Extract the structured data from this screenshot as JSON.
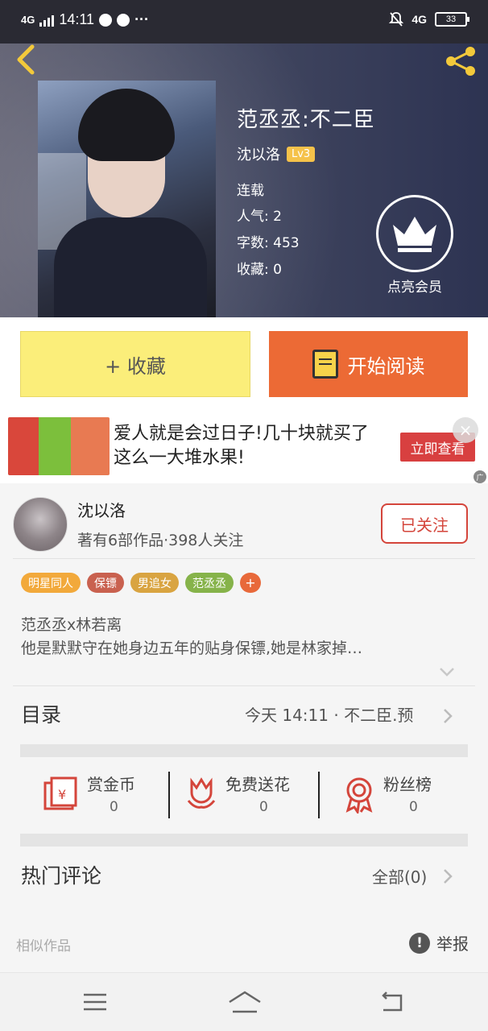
{
  "status_bar": {
    "network": "4G",
    "time": "14:11",
    "more": "···",
    "network_right": "4G",
    "battery": "33"
  },
  "book": {
    "title": "范丞丞:不二臣",
    "author": "沈以洛",
    "level": "Lv3",
    "status": "连载",
    "popularity_label": "人气:",
    "popularity": "2",
    "words_label": "字数:",
    "words": "453",
    "favorites_label": "收藏:",
    "favorites": "0"
  },
  "vip": {
    "label": "点亮会员"
  },
  "actions": {
    "collect": "+ 收藏",
    "read": "开始阅读"
  },
  "ad": {
    "text": "爱人就是会过日子!几十块就买了这么一大堆水果!",
    "cta": "立即查看",
    "close": "×",
    "mark": "广"
  },
  "author_card": {
    "name": "沈以洛",
    "stats": "著有6部作品·398人关注",
    "follow": "已关注"
  },
  "tags": [
    {
      "label": "明星同人",
      "color": "#f2a93b"
    },
    {
      "label": "保镖",
      "color": "#c9614f"
    },
    {
      "label": "男追女",
      "color": "#d9a441"
    },
    {
      "label": "范丞丞",
      "color": "#86b34a"
    },
    {
      "label": "+",
      "color": "#e8693a"
    }
  ],
  "synopsis": {
    "line1": "范丞丞x林若离",
    "line2": "他是默默守在她身边五年的贴身保镖,她是林家掉…"
  },
  "toc": {
    "label": "目录",
    "latest": "今天 14:11 · 不二臣.预"
  },
  "stats": [
    {
      "label": "赏金币",
      "value": "0"
    },
    {
      "label": "免费送花",
      "value": "0"
    },
    {
      "label": "粉丝榜",
      "value": "0"
    }
  ],
  "comments": {
    "label": "热门评论",
    "all": "全部(0)"
  },
  "footer": {
    "similar": "相似作品",
    "report": "举报",
    "report_icon": "!"
  },
  "colors": {
    "accent_orange": "#ec6a35",
    "collect_yellow": "#fbee7a",
    "follow_red": "#d4453b"
  }
}
